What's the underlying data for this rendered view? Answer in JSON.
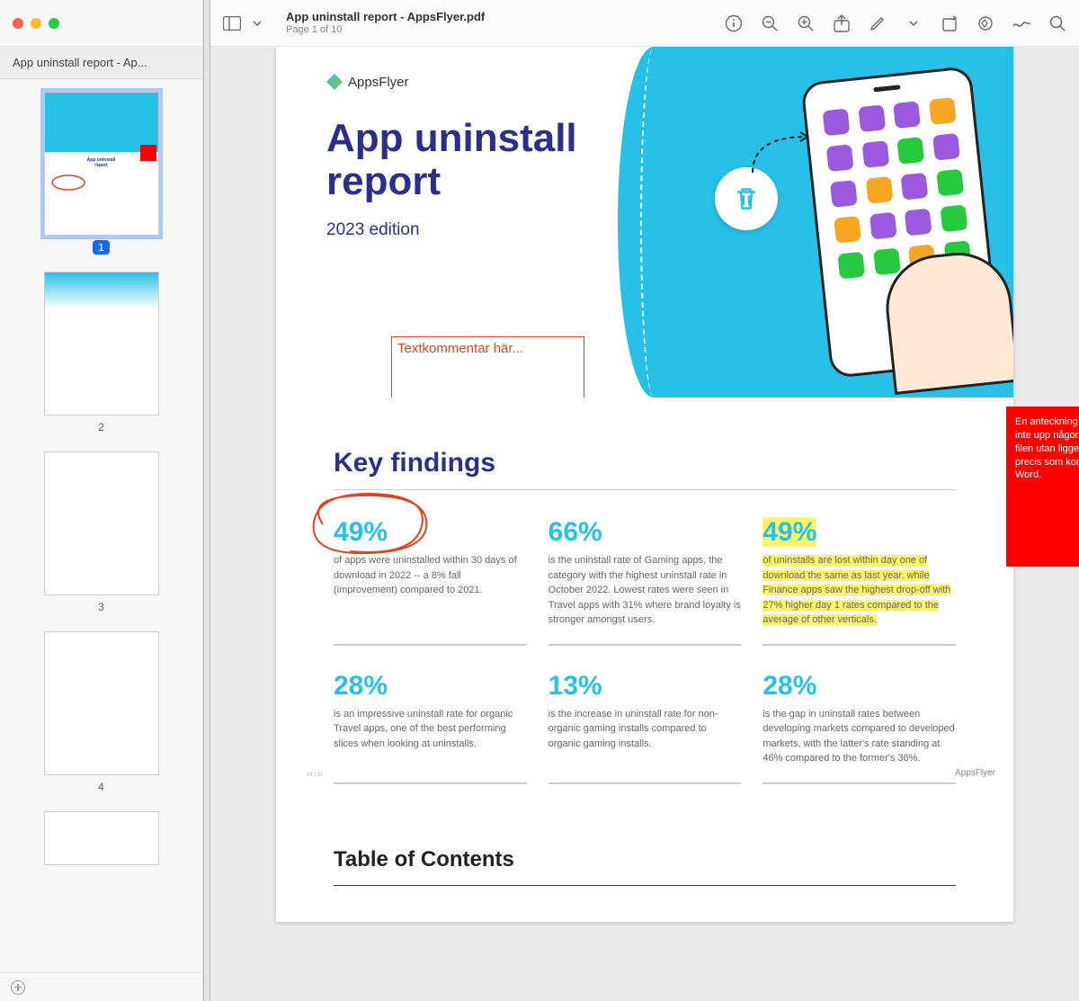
{
  "sidebar": {
    "tab": "App uninstall report - Ap..."
  },
  "thumbs": [
    "1",
    "2",
    "3",
    "4"
  ],
  "toolbar": {
    "file_title": "App uninstall report - AppsFlyer.pdf",
    "page_indicator": "Page 1 of 10"
  },
  "doc": {
    "brand": "AppsFlyer",
    "title_l1": "App uninstall",
    "title_l2": "report",
    "subtitle": "2023 edition",
    "annotation_placeholder": "Textkommentar här...",
    "sticky_note": "En anteckning i en pdf-fil tar inte upp någon plats i själva filen utan ligger vid sidan om, precis som kommentarer i Word.",
    "key_findings_title": "Key findings",
    "findings": [
      {
        "stat": "49%",
        "desc": "of apps were uninstalled within 30 days of download in 2022 -- a 8% fall (improvement) compared to 2021."
      },
      {
        "stat": "66%",
        "desc": "is the uninstall rate of Gaming apps, the category with the highest uninstall rate in October 2022. Lowest rates were seen in Travel apps with 31% where brand loyalty is stronger amongst users."
      },
      {
        "stat": "49%",
        "desc": "of uninstalls are lost within day one of download the same as last year, while Finance apps saw the highest drop-off with 27% higher day 1 rates compared to the average of other verticals."
      },
      {
        "stat": "28%",
        "desc": "is an impressive uninstall rate for organic Travel apps, one of the best performing slices when looking at uninstalls."
      },
      {
        "stat": "13%",
        "desc": "is the increase in uninstall rate for non-organic gaming installs compared to organic gaming installs."
      },
      {
        "stat": "28%",
        "desc": "is the gap in uninstall rates between developing markets compared to developed markets, with the latter's rate standing at 46% compared to the former's 36%."
      }
    ],
    "toc_title": "Table of Contents",
    "page_num_small": "#1 / 21",
    "brand_footer": "AppsFlyer"
  },
  "app_colors": [
    "#9b59e0",
    "#9b59e0",
    "#9b59e0",
    "#f5a623",
    "#9b59e0",
    "#9b59e0",
    "#27c93f",
    "#9b59e0",
    "#9b59e0",
    "#f5a623",
    "#9b59e0",
    "#27c93f",
    "#f5a623",
    "#9b59e0",
    "#9b59e0",
    "#27c93f",
    "#27c93f",
    "#27c93f",
    "#f5a623",
    "#27c93f"
  ]
}
